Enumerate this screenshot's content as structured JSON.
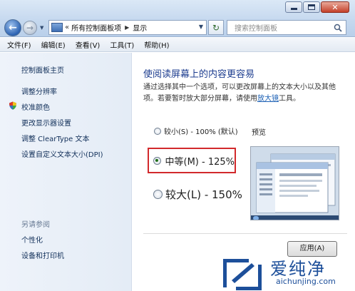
{
  "window": {
    "controls": {
      "minimize_icon": "minimize-icon",
      "maximize_icon": "maximize-icon",
      "close_icon": "close-icon"
    }
  },
  "nav": {
    "back_icon": "back-arrow-icon",
    "forward_icon": "forward-arrow-icon",
    "breadcrumb": [
      "所有控制面板项",
      "显示"
    ],
    "refresh_icon": "refresh-icon"
  },
  "search": {
    "placeholder": "搜索控制面板"
  },
  "menu": [
    "文件(F)",
    "编辑(E)",
    "查看(V)",
    "工具(T)",
    "帮助(H)"
  ],
  "sidebar": {
    "home": "控制面板主页",
    "links": [
      "调整分辨率",
      "校准颜色",
      "更改显示器设置",
      "调整 ClearType 文本",
      "设置自定义文本大小(DPI)"
    ],
    "see_also_title": "另请参阅",
    "see_also": [
      "个性化",
      "设备和打印机"
    ]
  },
  "main": {
    "heading": "使阅读屏幕上的内容更容易",
    "desc_before": "通过选择其中一个选项，可以更改屏幕上的文本大小以及其他项。若要暂时放大部分屏幕，请使用",
    "desc_link": "放大镜",
    "desc_after": "工具。",
    "options": [
      {
        "label": "较小(S) - 100% (默认)",
        "checked": false
      },
      {
        "label": "中等(M) - 125%",
        "checked": true
      },
      {
        "label": "较大(L) - 150%",
        "checked": false
      }
    ],
    "preview_label": "预览",
    "apply_button": "应用(A)"
  },
  "colors": {
    "heading": "#1d3d8f",
    "highlight_border": "#d2292c",
    "link": "#1a5fb4"
  },
  "watermark": {
    "text": "爱纯净",
    "url": "aichunjing.com"
  }
}
